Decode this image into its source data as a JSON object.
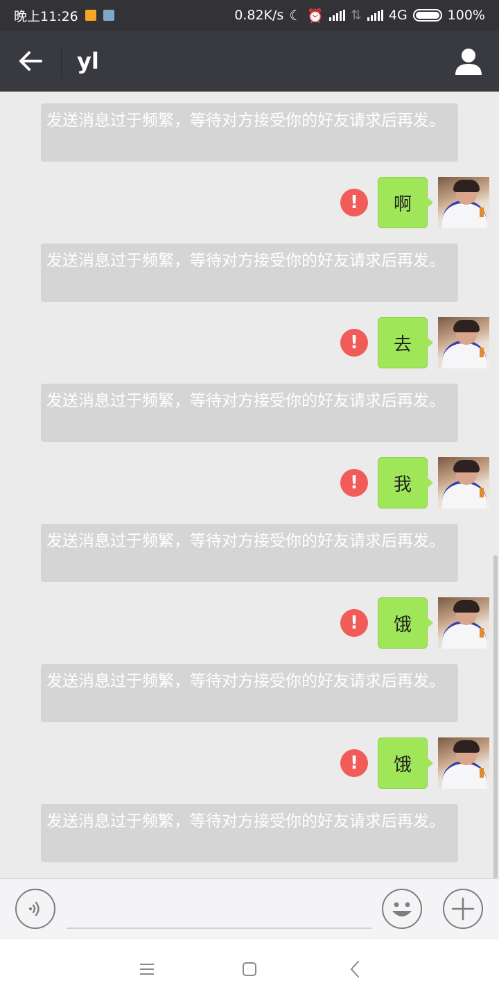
{
  "status_bar": {
    "time": "晚上11:26",
    "network_speed": "0.82K/s",
    "network_type": "4G",
    "battery": "100%",
    "notif_icon_1_color": "#f5a623",
    "notif_icon_2_color": "#7fa7c7"
  },
  "header": {
    "title": "yl",
    "back_icon": "arrow-left-icon",
    "profile_icon": "person-icon"
  },
  "system_notice": "发送消息过于频繁，等待对方接受你的好友请求后再发。",
  "messages": [
    {
      "text": "啊",
      "status": "failed"
    },
    {
      "text": "去",
      "status": "failed"
    },
    {
      "text": "我",
      "status": "failed"
    },
    {
      "text": "饿",
      "status": "failed"
    },
    {
      "text": "饿",
      "status": "failed"
    }
  ],
  "colors": {
    "bubble_green": "#9fe759",
    "error_red": "#f15b58",
    "header_bg": "#393a3f",
    "chat_bg": "#ebebeb"
  },
  "input_bar": {
    "placeholder": "",
    "voice_icon": "voice-icon",
    "emoji_icon": "emoji-icon",
    "plus_icon": "plus-icon"
  },
  "nav_bar": {
    "menu_icon": "menu-icon",
    "home_icon": "home-icon",
    "back_icon": "back-icon"
  }
}
